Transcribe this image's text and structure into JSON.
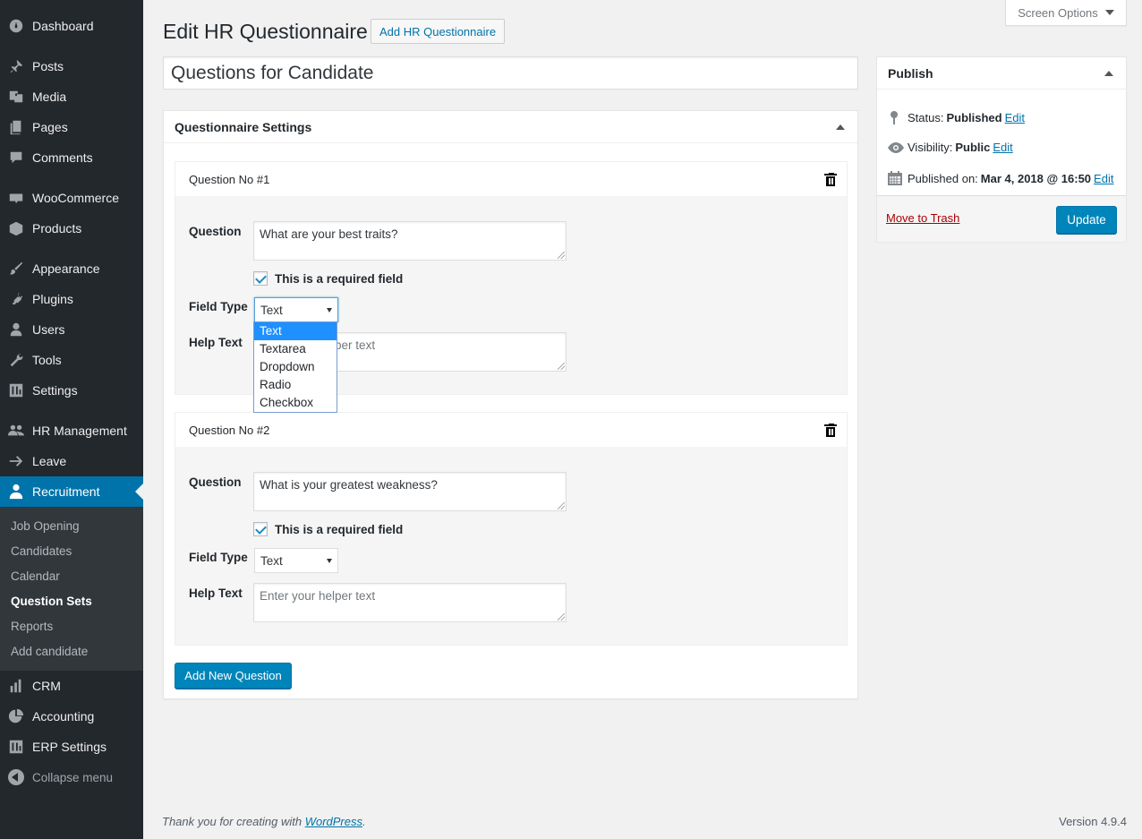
{
  "menu": {
    "items": [
      {
        "label": "Dashboard",
        "icon": "dashboard-icon"
      },
      {
        "label": "Posts",
        "icon": "pushpin-icon"
      },
      {
        "label": "Media",
        "icon": "media-icon"
      },
      {
        "label": "Pages",
        "icon": "pages-icon"
      },
      {
        "label": "Comments",
        "icon": "comment-icon"
      },
      {
        "label": "WooCommerce",
        "icon": "woocommerce-icon"
      },
      {
        "label": "Products",
        "icon": "box-icon"
      },
      {
        "label": "Appearance",
        "icon": "paintbrush-icon"
      },
      {
        "label": "Plugins",
        "icon": "plug-icon"
      },
      {
        "label": "Users",
        "icon": "user-icon"
      },
      {
        "label": "Tools",
        "icon": "wrench-icon"
      },
      {
        "label": "Settings",
        "icon": "settings-sliders-icon"
      },
      {
        "label": "HR Management",
        "icon": "people-icon"
      },
      {
        "label": "Leave",
        "icon": "arrow-right-icon"
      },
      {
        "label": "Recruitment",
        "icon": "recruit-person-icon"
      },
      {
        "label": "CRM",
        "icon": "bar-chart-icon"
      },
      {
        "label": "Accounting",
        "icon": "pie-chart-icon"
      },
      {
        "label": "ERP Settings",
        "icon": "settings-sliders-icon"
      }
    ],
    "submenu": [
      "Job Opening",
      "Candidates",
      "Calendar",
      "Question Sets",
      "Reports",
      "Add candidate"
    ],
    "collapse_label": "Collapse menu"
  },
  "header": {
    "title": "Edit HR Questionnaire",
    "add_new": "Add HR Questionnaire",
    "screen_options": "Screen Options"
  },
  "post_title": "Questions for Candidate",
  "settings": {
    "title": "Questionnaire Settings",
    "question_label": "Question",
    "required_label": "This is a required field",
    "field_type_label": "Field Type",
    "help_text_label": "Help Text",
    "questions": [
      {
        "heading": "Question No #1",
        "question": "What are your best traits?",
        "field_type": "Text",
        "help_placeholder": "Enter your helper text"
      },
      {
        "heading": "Question No #2",
        "question": "What is your greatest weakness?",
        "field_type": "Text",
        "help_placeholder": "Enter your helper text"
      }
    ],
    "field_type_options": [
      "Text",
      "Textarea",
      "Dropdown",
      "Radio",
      "Checkbox"
    ],
    "add_button": "Add New Question"
  },
  "publish": {
    "title": "Publish",
    "status_label": "Status:",
    "status_value": "Published",
    "visibility_label": "Visibility:",
    "visibility_value": "Public",
    "published_label": "Published on:",
    "published_value": "Mar 4, 2018 @ 16:50",
    "edit": "Edit",
    "trash": "Move to Trash",
    "update": "Update"
  },
  "footer": {
    "thanks_prefix": "Thank you for creating with ",
    "thanks_link": "WordPress",
    "thanks_suffix": ".",
    "version": "Version 4.9.4"
  },
  "colors": {
    "menu_bg": "#23282d",
    "submenu_bg": "#32373c",
    "accent": "#0073aa",
    "button": "#0085ba",
    "trash_link": "#a00"
  }
}
